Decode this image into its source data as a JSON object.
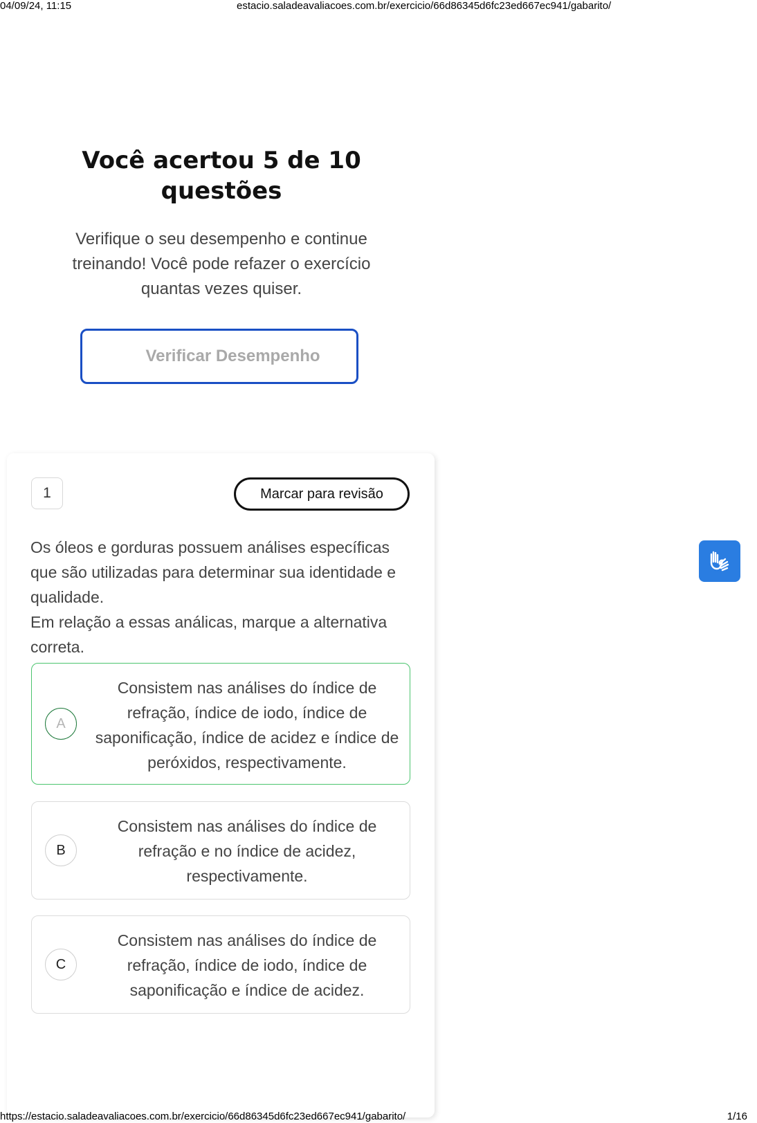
{
  "print_header": {
    "datetime": "04/09/24, 11:15",
    "url": "estacio.saladeavaliacoes.com.br/exercicio/66d86345d6fc23ed667ec941/gabarito/"
  },
  "print_footer": {
    "url": "https://estacio.saladeavaliacoes.com.br/exercicio/66d86345d6fc23ed667ec941/gabarito/",
    "page": "1/16"
  },
  "result": {
    "title": "Você acertou 5 de 10 questões",
    "subtitle": "Verifique o seu desempenho e continue treinando! Você pode refazer o exercício quantas vezes quiser.",
    "button_label": "Verificar Desempenho"
  },
  "question": {
    "number": "1",
    "review_button": "Marcar para revisão",
    "paragraphs": [
      "Os óleos e gorduras possuem análises específicas que são utilizadas para determinar sua identidade e qualidade.",
      "Em relação a essas análicas, marque a alternativa correta."
    ],
    "options": [
      {
        "letter": "A",
        "text": "Consistem nas análises do índice de refração, índice de iodo, índice de saponificação, índice de acidez e índice de peróxidos, respectivamente.",
        "status": "correct"
      },
      {
        "letter": "B",
        "text": "Consistem nas análises do índice de refração e no índice de acidez, respectivamente.",
        "status": "neutral"
      },
      {
        "letter": "C",
        "text": "Consistem nas análises do índice de refração, índice de iodo, índice de saponificação e índice de acidez.",
        "status": "neutral"
      }
    ]
  },
  "accessibility_widget": {
    "icon": "sign-language-hands-icon"
  },
  "colors": {
    "primary_border": "#1a4fc4",
    "correct_border": "#4bc46e",
    "widget_bg": "#2a7de1"
  }
}
